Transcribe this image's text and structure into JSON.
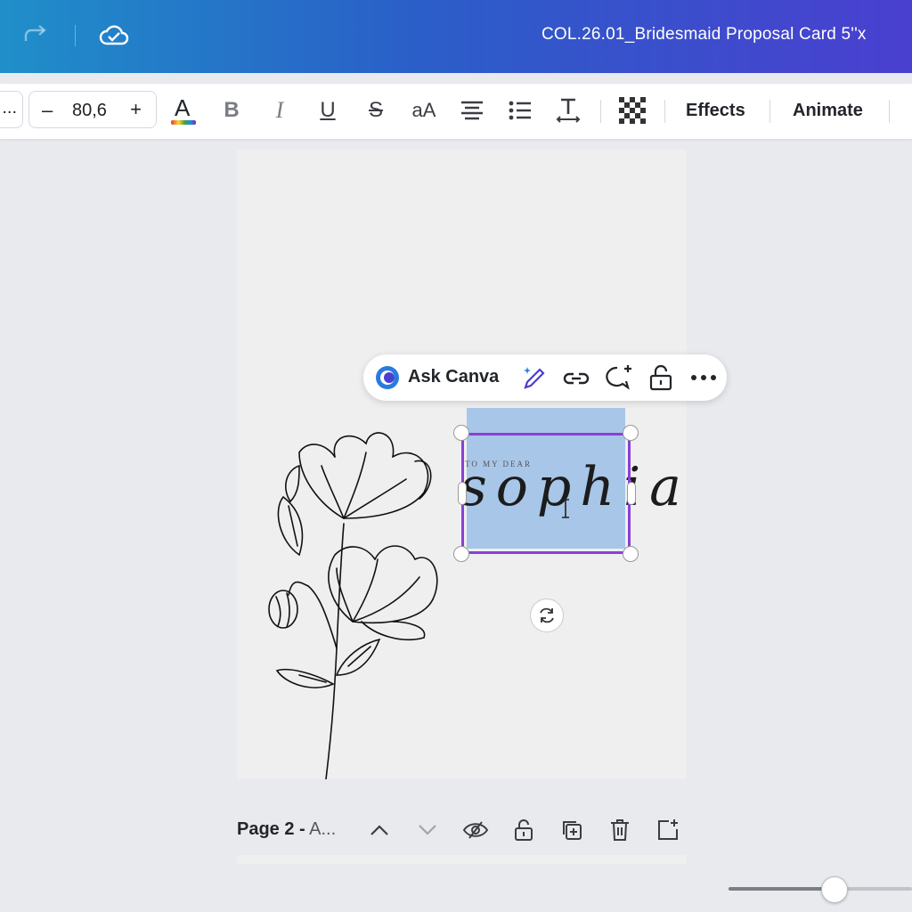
{
  "topbar": {
    "doc_title": "COL.26.01_Bridesmaid Proposal Card 5''x"
  },
  "toolbar": {
    "font_stub": "...",
    "size_decrease": "–",
    "font_size": "80,6",
    "size_increase": "+",
    "case_label": "aA",
    "effects_label": "Effects",
    "animate_label": "Animate",
    "text_color": "#1c1c1c"
  },
  "floatbar": {
    "ask_label": "Ask Canva"
  },
  "canvas": {
    "kicker_text": "TO MY DEAR",
    "name_text": "sophia",
    "selection_color": "#8b3fd6",
    "highlight_color": "#a8c6e8"
  },
  "page_controls": {
    "page_bold": "Page 2 -",
    "page_rest": " A..."
  },
  "zoom": {
    "level": 0.57
  }
}
